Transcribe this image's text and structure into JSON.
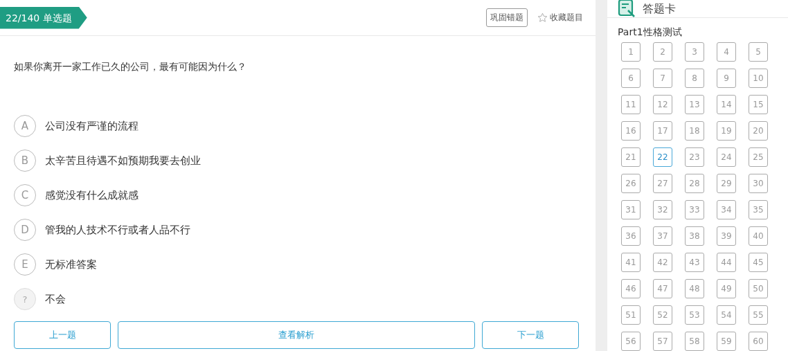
{
  "question_header": {
    "progress": "22/140",
    "type": "单选题",
    "actions": [
      {
        "kind": "outlined",
        "label": "巩固错题"
      },
      {
        "kind": "star",
        "label": "收藏题目"
      }
    ]
  },
  "question": {
    "text": "如果你离开一家工作已久的公司，最有可能因为什么？",
    "options": [
      {
        "letter": "A",
        "text": "公司没有严谨的流程",
        "kind": "letter"
      },
      {
        "letter": "B",
        "text": "太辛苦且待遇不如预期我要去创业",
        "kind": "letter"
      },
      {
        "letter": "C",
        "text": "感觉没有什么成就感",
        "kind": "letter"
      },
      {
        "letter": "D",
        "text": "管我的人技术不行或者人品不行",
        "kind": "letter"
      },
      {
        "letter": "E",
        "text": "无标准答案",
        "kind": "letter"
      },
      {
        "letter": "?",
        "text": "不会",
        "kind": "unknown"
      }
    ]
  },
  "buttons": [
    "上一题",
    "查看解析",
    "下一题"
  ],
  "answer_card": {
    "title": "答题卡",
    "section": "Part1性格测试",
    "numbers": [
      {
        "label": "1",
        "selected": false
      },
      {
        "label": "2",
        "selected": false
      },
      {
        "label": "3",
        "selected": false
      },
      {
        "label": "4",
        "selected": false
      },
      {
        "label": "5",
        "selected": false
      },
      {
        "label": "6",
        "selected": false
      },
      {
        "label": "7",
        "selected": false
      },
      {
        "label": "8",
        "selected": false
      },
      {
        "label": "9",
        "selected": false
      },
      {
        "label": "10",
        "selected": false
      },
      {
        "label": "11",
        "selected": false
      },
      {
        "label": "12",
        "selected": false
      },
      {
        "label": "13",
        "selected": false
      },
      {
        "label": "14",
        "selected": false
      },
      {
        "label": "15",
        "selected": false
      },
      {
        "label": "16",
        "selected": false
      },
      {
        "label": "17",
        "selected": false
      },
      {
        "label": "18",
        "selected": false
      },
      {
        "label": "19",
        "selected": false
      },
      {
        "label": "20",
        "selected": false
      },
      {
        "label": "21",
        "selected": false
      },
      {
        "label": "22",
        "selected": true
      },
      {
        "label": "23",
        "selected": false
      },
      {
        "label": "24",
        "selected": false
      },
      {
        "label": "25",
        "selected": false
      },
      {
        "label": "26",
        "selected": false
      },
      {
        "label": "27",
        "selected": false
      },
      {
        "label": "28",
        "selected": false
      },
      {
        "label": "29",
        "selected": false
      },
      {
        "label": "30",
        "selected": false
      },
      {
        "label": "31",
        "selected": false
      },
      {
        "label": "32",
        "selected": false
      },
      {
        "label": "33",
        "selected": false
      },
      {
        "label": "34",
        "selected": false
      },
      {
        "label": "35",
        "selected": false
      },
      {
        "label": "36",
        "selected": false
      },
      {
        "label": "37",
        "selected": false
      },
      {
        "label": "38",
        "selected": false
      },
      {
        "label": "39",
        "selected": false
      },
      {
        "label": "40",
        "selected": false
      },
      {
        "label": "41",
        "selected": false
      },
      {
        "label": "42",
        "selected": false
      },
      {
        "label": "43",
        "selected": false
      },
      {
        "label": "44",
        "selected": false
      },
      {
        "label": "45",
        "selected": false
      },
      {
        "label": "46",
        "selected": false
      },
      {
        "label": "47",
        "selected": false
      },
      {
        "label": "48",
        "selected": false
      },
      {
        "label": "49",
        "selected": false
      },
      {
        "label": "50",
        "selected": false
      },
      {
        "label": "51",
        "selected": false
      },
      {
        "label": "52",
        "selected": false
      },
      {
        "label": "53",
        "selected": false
      },
      {
        "label": "54",
        "selected": false
      },
      {
        "label": "55",
        "selected": false
      },
      {
        "label": "56",
        "selected": false
      },
      {
        "label": "57",
        "selected": false
      },
      {
        "label": "58",
        "selected": false
      },
      {
        "label": "59",
        "selected": false
      },
      {
        "label": "60",
        "selected": false
      }
    ]
  }
}
